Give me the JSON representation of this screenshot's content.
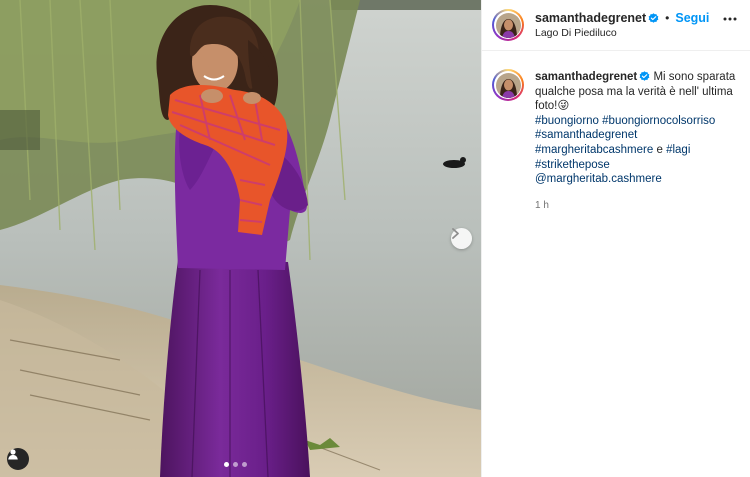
{
  "post": {
    "username": "samanthadegrenet",
    "location": "Lago Di Piediluco",
    "follow_label": "Segui",
    "separator": "•"
  },
  "caption": {
    "username": "samanthadegrenet",
    "text": "Mi sono sparata qualche posa ma la verità è nell' ultima foto!😜",
    "hashtags": [
      "#buongiorno",
      "#buongiornocolsorriso",
      "#samanthadegrenet",
      "#margheritabcashmere",
      "#lagi",
      "#strikethepose"
    ],
    "conjunction": "e",
    "mention": "@margheritab.cashmere",
    "time": "1 h"
  },
  "carousel": {
    "slide_count": 3,
    "active_index": 0
  },
  "icons": {
    "verified": "verified-badge-icon",
    "more": "more-options-icon",
    "next": "chevron-right-icon",
    "tagged": "user-tag-icon"
  },
  "colors": {
    "accent": "#0095f6",
    "link": "#00376b",
    "verified": "#0095f6",
    "skirt": "#6a1f8a",
    "sweater": "#7b2aa0",
    "scarf": "#e8552a"
  }
}
